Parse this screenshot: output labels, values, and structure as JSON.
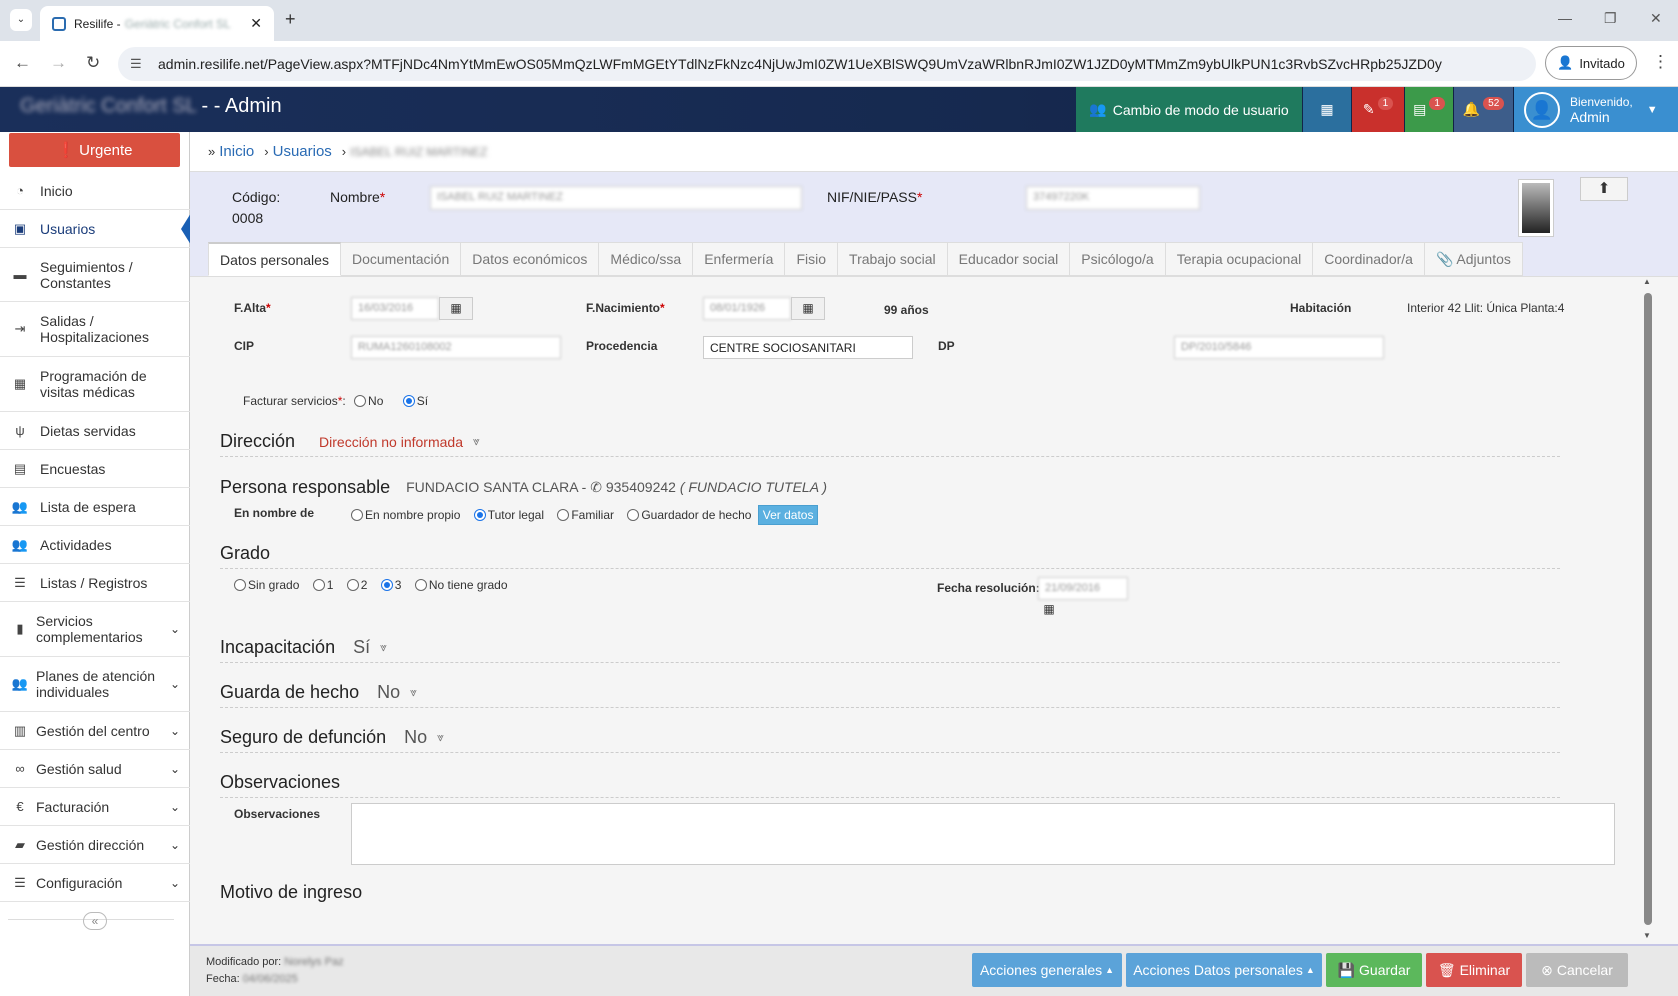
{
  "browser": {
    "tab_title": "Resilife - ",
    "tab_title_blurred": "Geriàtric Confort SL",
    "url": "admin.resilife.net/PageView.aspx?MTFjNDc4NmYtMmEwOS05MmQzLWFmMGEtYTdlNzFkNzc4NjUwJmI0ZW1UeXBlSWQ9UmVzaWRlbnRJmI0ZW1JZD0yMTMmZm9ybUlkPUN1c3RvbSZvcHRpb25JZD0y",
    "profile": "Invitado"
  },
  "topbar": {
    "brand_blurred": "Geriàtric Confort SL",
    "brand_suffix": " - - Admin",
    "mode_button": "Cambio de modo de usuario",
    "badge_a": "1",
    "badge_b": "1",
    "badge_c": "52",
    "welcome": "Bienvenido,",
    "user": "Admin",
    "colors": {
      "mode": "#1f7a5e",
      "calendar": "#2b6f9e",
      "red": "#c9302c",
      "green": "#3c9a4a",
      "bell": "#3d5d8a",
      "user": "#3a8fd0"
    }
  },
  "sidebar": {
    "urgent": "Urgente",
    "items": [
      {
        "label": "Inicio",
        "icon": "dashboard-icon"
      },
      {
        "label": "Usuarios",
        "icon": "user-icon"
      },
      {
        "label": "Seguimientos / Constantes",
        "icon": "notes-icon"
      },
      {
        "label": "Salidas / Hospitalizaciones",
        "icon": "exit-icon"
      },
      {
        "label": "Programación de visitas médicas",
        "icon": "calendar-icon"
      },
      {
        "label": "Dietas servidas",
        "icon": "cutlery-icon"
      },
      {
        "label": "Encuestas",
        "icon": "document-icon"
      },
      {
        "label": "Lista de espera",
        "icon": "users-icon"
      },
      {
        "label": "Actividades",
        "icon": "group-icon"
      },
      {
        "label": "Listas / Registros",
        "icon": "list-icon"
      },
      {
        "label": "Servicios complementarios",
        "icon": "clipboard-icon"
      },
      {
        "label": "Planes de atención individuales",
        "icon": "users-icon"
      },
      {
        "label": "Gestión del centro",
        "icon": "building-icon"
      },
      {
        "label": "Gestión salud",
        "icon": "glasses-icon"
      },
      {
        "label": "Facturación",
        "icon": "euro-icon"
      },
      {
        "label": "Gestión dirección",
        "icon": "briefcase-icon"
      },
      {
        "label": "Configuración",
        "icon": "list-icon"
      }
    ]
  },
  "breadcrumb": {
    "home": "Inicio",
    "users": "Usuarios",
    "current_blurred": "ISABEL RUIZ MARTINEZ"
  },
  "header": {
    "code_label": "Código:",
    "code_value": "0008",
    "name_label": "Nombre",
    "name_value": "ISABEL RUIZ MARTINEZ",
    "nif_label": "NIF/NIE/PASS",
    "nif_value": "37497220K"
  },
  "tabs": [
    "Datos personales",
    "Documentación",
    "Datos económicos",
    "Médico/ssa",
    "Enfermería",
    "Fisio",
    "Trabajo social",
    "Educador social",
    "Psicólogo/a",
    "Terapia ocupacional",
    "Coordinador/a",
    "Adjuntos"
  ],
  "form": {
    "alta_label": "F.Alta",
    "alta_value": "16/03/2016",
    "nac_label": "F.Nacimiento",
    "nac_value": "08/01/1926",
    "age": "99 años",
    "hab_label": "Habitación",
    "hab_value": "Interior 42 Llit: Única Planta:4",
    "cip_label": "CIP",
    "cip_value": "RUMA1260108002",
    "proc_label": "Procedencia",
    "proc_value": "CENTRE SOCIOSANITARI",
    "dp_label": "DP",
    "dp_value": "DP/2010/5846",
    "facturar_label": "Facturar servicios",
    "facturar_no": "No",
    "facturar_si": "Sí",
    "direccion_title": "Dirección",
    "direccion_status": "Dirección no informada",
    "persona_title": "Persona responsable",
    "persona_info": "FUNDACIO SANTA CLARA - ",
    "persona_phone": "935409242",
    "persona_rel": "( FUNDACIO TUTELA )",
    "en_nombre_label": "En nombre de",
    "en_nombre_opts": [
      "En nombre propio",
      "Tutor legal",
      "Familiar",
      "Guardador de hecho"
    ],
    "ver_datos": "Ver datos",
    "grado_title": "Grado",
    "grado_opts": [
      "Sin grado",
      "1",
      "2",
      "3",
      "No tiene grado"
    ],
    "fecha_res_label": "Fecha resolución:",
    "fecha_res_value": "21/09/2016",
    "incap_title": "Incapacitación",
    "incap_value": "Sí",
    "guarda_title": "Guarda de hecho",
    "guarda_value": "No",
    "seguro_title": "Seguro de defunción",
    "seguro_value": "No",
    "obs_title": "Observaciones",
    "obs_label": "Observaciones",
    "motivo_title": "Motivo de ingreso"
  },
  "footer": {
    "modified_label": "Modificado por: ",
    "modified_value": "Norelys Paz",
    "date_label": "Fecha: ",
    "date_value": "04/06/2025",
    "btn_general": "Acciones generales",
    "btn_personal": "Acciones Datos personales",
    "btn_save": "Guardar",
    "btn_delete": "Eliminar",
    "btn_cancel": "Cancelar"
  }
}
